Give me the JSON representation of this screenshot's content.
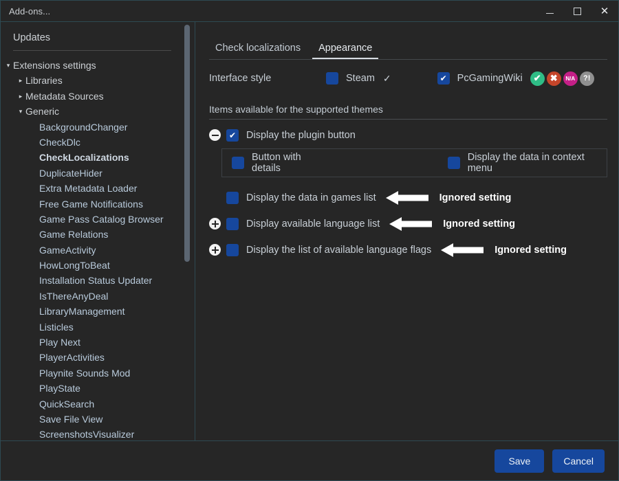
{
  "window": {
    "title": "Add-ons...",
    "controls": {
      "minimize": "–",
      "maximize": "□",
      "close": "✕"
    }
  },
  "sidebar": {
    "updates_label": "Updates",
    "tree": [
      {
        "label": "Extensions settings",
        "level": 0,
        "arrow": "▾",
        "type": "node"
      },
      {
        "label": "Libraries",
        "level": 1,
        "arrow": "▸",
        "type": "node"
      },
      {
        "label": "Metadata Sources",
        "level": 1,
        "arrow": "▸",
        "type": "node"
      },
      {
        "label": "Generic",
        "level": 1,
        "arrow": "▾",
        "type": "node"
      },
      {
        "label": "BackgroundChanger",
        "level": 2,
        "type": "leaf"
      },
      {
        "label": "CheckDlc",
        "level": 2,
        "type": "leaf"
      },
      {
        "label": "CheckLocalizations",
        "level": 2,
        "type": "leaf",
        "selected": true
      },
      {
        "label": "DuplicateHider",
        "level": 2,
        "type": "leaf"
      },
      {
        "label": "Extra Metadata Loader",
        "level": 2,
        "type": "leaf"
      },
      {
        "label": "Free Game Notifications",
        "level": 2,
        "type": "leaf"
      },
      {
        "label": "Game Pass Catalog Browser",
        "level": 2,
        "type": "leaf"
      },
      {
        "label": "Game Relations",
        "level": 2,
        "type": "leaf"
      },
      {
        "label": "GameActivity",
        "level": 2,
        "type": "leaf"
      },
      {
        "label": "HowLongToBeat",
        "level": 2,
        "type": "leaf"
      },
      {
        "label": "Installation Status Updater",
        "level": 2,
        "type": "leaf"
      },
      {
        "label": "IsThereAnyDeal",
        "level": 2,
        "type": "leaf"
      },
      {
        "label": "LibraryManagement",
        "level": 2,
        "type": "leaf"
      },
      {
        "label": "Listicles",
        "level": 2,
        "type": "leaf"
      },
      {
        "label": "Play Next",
        "level": 2,
        "type": "leaf"
      },
      {
        "label": "PlayerActivities",
        "level": 2,
        "type": "leaf"
      },
      {
        "label": "Playnite Sounds Mod",
        "level": 2,
        "type": "leaf"
      },
      {
        "label": "PlayState",
        "level": 2,
        "type": "leaf"
      },
      {
        "label": "QuickSearch",
        "level": 2,
        "type": "leaf"
      },
      {
        "label": "Save File View",
        "level": 2,
        "type": "leaf"
      },
      {
        "label": "ScreenshotsVisualizer",
        "level": 2,
        "type": "leaf"
      }
    ]
  },
  "main": {
    "tabs": [
      {
        "label": "Check localizations",
        "active": false
      },
      {
        "label": "Appearance",
        "active": true
      }
    ],
    "interface_style": {
      "label": "Interface style",
      "steam": {
        "label": "Steam",
        "checked": false,
        "tick": "✓"
      },
      "pcgamingwiki": {
        "label": "PcGamingWiki",
        "checked": true
      },
      "status_icons": [
        {
          "name": "check-circle-icon",
          "glyph": "✔",
          "color": "#2fbd86"
        },
        {
          "name": "error-circle-icon",
          "glyph": "✖",
          "color": "#c4452a"
        },
        {
          "name": "na-circle-icon",
          "glyph": "N/A",
          "color": "#c41f87"
        },
        {
          "name": "unknown-circle-icon",
          "glyph": "?!",
          "color": "#909090"
        }
      ]
    },
    "section_title": "Items available for the supported themes",
    "plugin_button": {
      "label": "Display the plugin button",
      "checked": true,
      "toggle": "minus"
    },
    "sub_options": [
      {
        "label": "Button with details",
        "checked": false
      },
      {
        "label": "Display the data in context menu",
        "checked": false
      }
    ],
    "ignored_rows": [
      {
        "label": "Display the data in games list",
        "checked": false,
        "toggle": "none",
        "annotation": "Ignored setting"
      },
      {
        "label": "Display available language list",
        "checked": false,
        "toggle": "plus",
        "annotation": "Ignored setting"
      },
      {
        "label": "Display the list of available language flags",
        "checked": false,
        "toggle": "plus",
        "annotation": "Ignored setting"
      }
    ]
  },
  "footer": {
    "save_label": "Save",
    "cancel_label": "Cancel"
  },
  "colors": {
    "accent_blue": "#16479d",
    "window_bg": "#262626",
    "border_teal": "#2e4a52",
    "text": "#c9d0d7"
  }
}
